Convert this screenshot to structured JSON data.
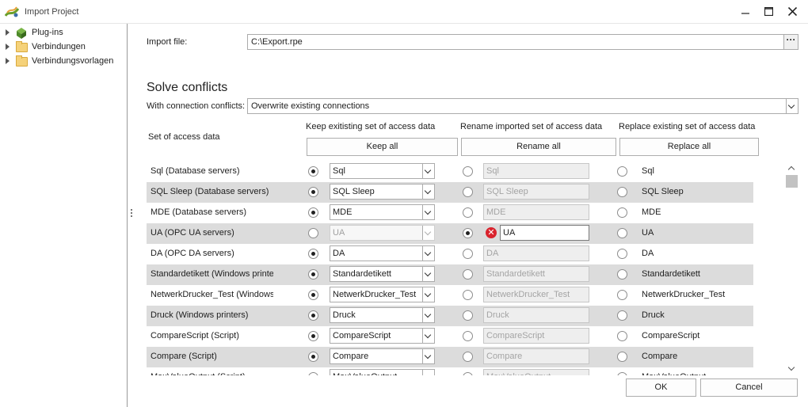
{
  "window": {
    "title": "Import Project",
    "min_glyph": "—",
    "max_glyph": "☐",
    "close_glyph": "✕"
  },
  "tree": {
    "items": [
      {
        "label": "Plug-ins",
        "icon": "plugin-icon"
      },
      {
        "label": "Verbindungen",
        "icon": "folder-icon"
      },
      {
        "label": "Verbindungsvorlagen",
        "icon": "folder-icon"
      }
    ]
  },
  "import_file": {
    "label": "Import file:",
    "value": "C:\\Export.rpe",
    "browse_label": "···"
  },
  "conflicts": {
    "title": "Solve conflicts",
    "connection_label": "With connection conflicts:",
    "connection_value": "Overwrite existing connections"
  },
  "columns": {
    "set_header": "Set of access data",
    "keep_header": "Keep exitisting set of access data",
    "rename_header": "Rename imported set of access data",
    "replace_header": "Replace existing set of access data",
    "keep_all": "Keep all",
    "rename_all": "Rename all",
    "replace_all": "Replace all"
  },
  "rows": [
    {
      "name": "Sql (Database servers)",
      "keep": "Sql",
      "rename": "Sql",
      "replace": "Sql",
      "selected": "keep"
    },
    {
      "name": "SQL Sleep (Database servers)",
      "keep": "SQL Sleep",
      "rename": "SQL Sleep",
      "replace": "SQL Sleep",
      "selected": "keep"
    },
    {
      "name": "MDE (Database servers)",
      "keep": "MDE",
      "rename": "MDE",
      "replace": "MDE",
      "selected": "keep"
    },
    {
      "name": "UA (OPC UA servers)",
      "keep": "UA",
      "rename": "UA",
      "replace": "UA",
      "selected": "rename",
      "error": true
    },
    {
      "name": "DA (OPC DA servers)",
      "keep": "DA",
      "rename": "DA",
      "replace": "DA",
      "selected": "keep"
    },
    {
      "name": "Standardetikett (Windows printe",
      "keep": "Standardetikett",
      "rename": "Standardetikett",
      "replace": "Standardetikett",
      "selected": "keep"
    },
    {
      "name": "NetwerkDrucker_Test (Windows",
      "keep": "NetwerkDrucker_Test",
      "rename": "NetwerkDrucker_Test",
      "replace": "NetwerkDrucker_Test",
      "selected": "keep"
    },
    {
      "name": "Druck (Windows printers)",
      "keep": "Druck",
      "rename": "Druck",
      "replace": "Druck",
      "selected": "keep"
    },
    {
      "name": "CompareScript (Script)",
      "keep": "CompareScript",
      "rename": "CompareScript",
      "replace": "CompareScript",
      "selected": "keep"
    },
    {
      "name": "Compare (Script)",
      "keep": "Compare",
      "rename": "Compare",
      "replace": "Compare",
      "selected": "keep"
    },
    {
      "name": "MaxValueOutput (Script)",
      "keep": "MaxValueOutput",
      "rename": "MaxValueOutput",
      "replace": "MaxValueOutput",
      "selected": "keep"
    }
  ],
  "footer": {
    "ok": "OK",
    "cancel": "Cancel"
  },
  "colors": {
    "row_shade": "#dcdcdc",
    "error": "#d9232d",
    "border": "#ababab"
  }
}
